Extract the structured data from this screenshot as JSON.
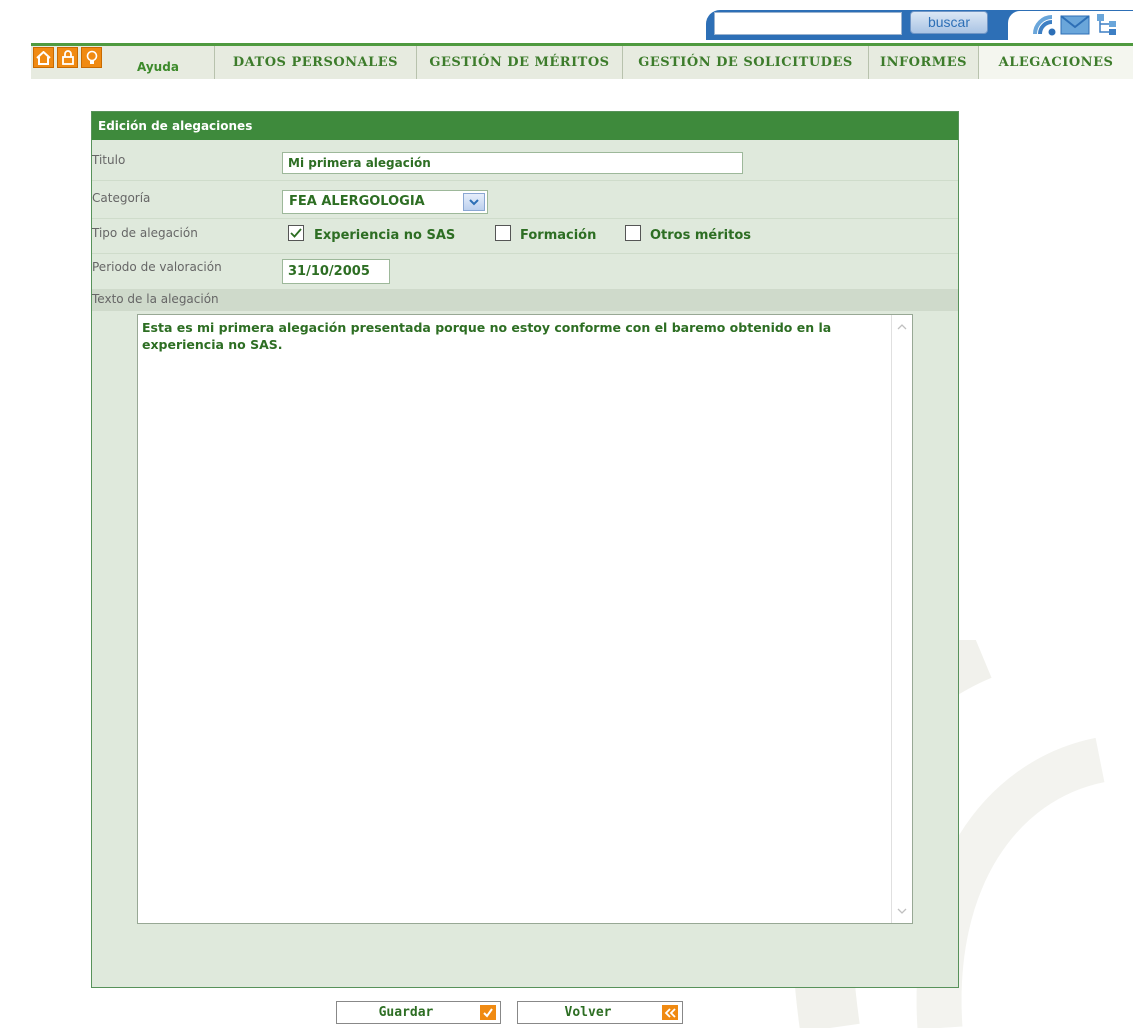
{
  "header": {
    "search": {
      "value": "",
      "button_label": "buscar"
    },
    "icons": [
      "rss-icon",
      "mail-icon",
      "sitemap-icon"
    ]
  },
  "nav": {
    "home_icons": [
      "home-icon",
      "lock-icon",
      "bulb-icon"
    ],
    "help_label": "Ayuda",
    "tabs": [
      {
        "label": "DATOS PERSONALES",
        "active": false
      },
      {
        "label": "GESTIÓN DE MÉRITOS",
        "active": false
      },
      {
        "label": "GESTIÓN DE SOLICITUDES",
        "active": false
      },
      {
        "label": "INFORMES",
        "active": false
      },
      {
        "label": "ALEGACIONES",
        "active": true
      }
    ]
  },
  "form": {
    "title": "Edición de alegaciones",
    "fields": {
      "titulo": {
        "label": "Titulo",
        "value": "Mi primera alegación"
      },
      "categoria": {
        "label": "Categoría",
        "selected": "FEA ALERGOLOGIA"
      },
      "tipo": {
        "label": "Tipo de alegación",
        "options": [
          {
            "label": "Experiencia no SAS",
            "checked": true
          },
          {
            "label": "Formación",
            "checked": false
          },
          {
            "label": "Otros méritos",
            "checked": false
          }
        ]
      },
      "periodo": {
        "label": "Periodo de valoración",
        "value": "31/10/2005"
      },
      "texto": {
        "label": "Texto de la alegación",
        "value": "Esta es mi primera alegación presentada porque no estoy conforme con el baremo obtenido en la experiencia no SAS."
      }
    }
  },
  "actions": {
    "guardar_label": "Guardar",
    "volver_label": "Volver"
  },
  "colors": {
    "primary_green": "#3e8a3c",
    "text_green": "#2d6e23",
    "panel_bg": "#dfe9dc",
    "accent_orange": "#f08a12",
    "header_blue": "#2d6fb6"
  }
}
